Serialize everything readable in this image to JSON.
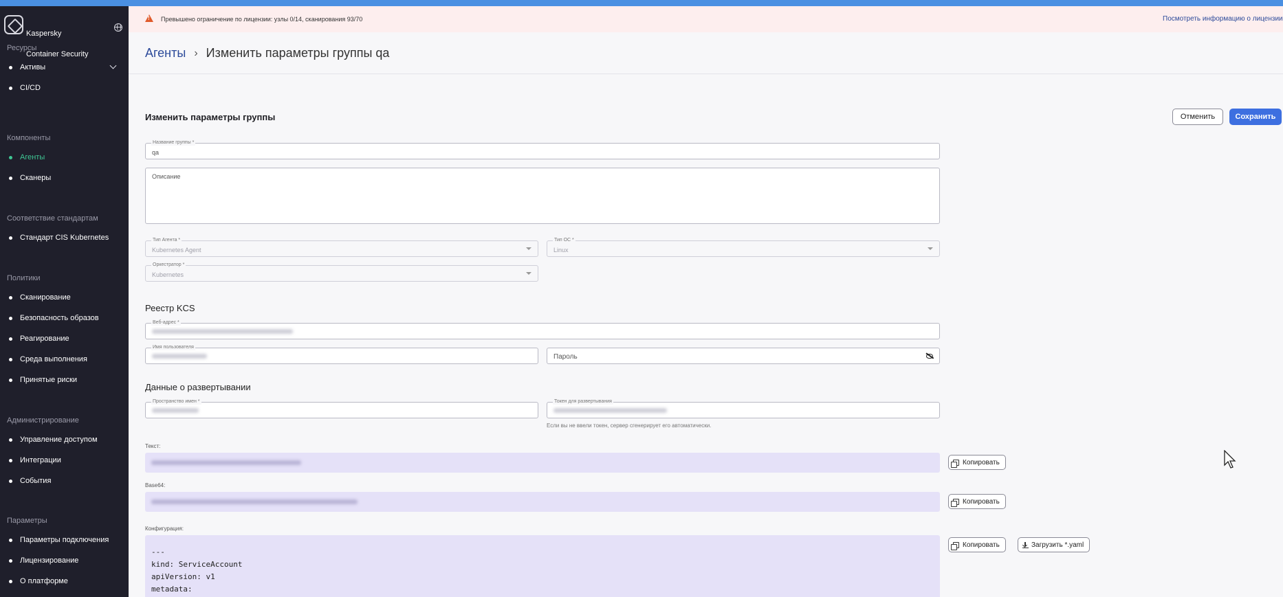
{
  "app": {
    "brand_line1": "Kaspersky",
    "brand_line2": "Container Security"
  },
  "sidebar": {
    "sections": [
      {
        "title": "Ресурсы",
        "items": [
          {
            "label": "Активы",
            "expandable": true
          },
          {
            "label": "CI/CD"
          }
        ]
      },
      {
        "title": "Компоненты",
        "items": [
          {
            "label": "Агенты",
            "active": true
          },
          {
            "label": "Сканеры"
          }
        ]
      },
      {
        "title": "Соответствие стандартам",
        "items": [
          {
            "label": "Стандарт CIS Kubernetes"
          }
        ]
      },
      {
        "title": "Политики",
        "items": [
          {
            "label": "Сканирование"
          },
          {
            "label": "Безопасность образов"
          },
          {
            "label": "Реагирование"
          },
          {
            "label": "Среда выполнения"
          },
          {
            "label": "Принятые риски"
          }
        ]
      },
      {
        "title": "Администрирование",
        "items": [
          {
            "label": "Управление доступом"
          },
          {
            "label": "Интеграции"
          },
          {
            "label": "События"
          }
        ]
      },
      {
        "title": "Параметры",
        "items": [
          {
            "label": "Параметры подключения"
          },
          {
            "label": "Лицензирование"
          },
          {
            "label": "О платформе"
          }
        ]
      }
    ]
  },
  "banner": {
    "text": "Превышено ограничение по лицензии: узлы 0/14, сканирования 93/70",
    "link": "Посмотреть информацию о лицензии"
  },
  "breadcrumb": {
    "parent": "Агенты",
    "separator": "›",
    "current": "Изменить параметры группы qa"
  },
  "form": {
    "title": "Изменить параметры группы",
    "cancel_label": "Отменить",
    "save_label": "Сохранить",
    "group_name": {
      "label": "Название группы *",
      "value": "qa"
    },
    "description": {
      "placeholder": "Описание"
    },
    "agent_type": {
      "label": "Тип Агента *",
      "value": "Kubernetes Agent"
    },
    "os_type": {
      "label": "Тип ОС *",
      "value": "Linux"
    },
    "orchestrator": {
      "label": "Оркестратор *",
      "value": "Kubernetes"
    },
    "registry_title": "Реестр KCS",
    "web_address": {
      "label": "Веб-адрес *"
    },
    "username": {
      "label": "Имя пользователя"
    },
    "password": {
      "placeholder": "Пароль"
    },
    "deploy_title": "Данные о развертывании",
    "namespace": {
      "label": "Пространство имен *"
    },
    "token": {
      "label": "Токен для развертывания",
      "hint": "Если вы не ввели токен, сервер сгенерирует его автоматически."
    },
    "text_label": "Текст:",
    "base64_label": "Base64:",
    "config_label": "Конфигурация:",
    "copy_label": "Копировать",
    "upload_label": "Загрузить *.yaml",
    "config_lines": [
      "---",
      "kind: ServiceAccount",
      "apiVersion: v1",
      "metadata:"
    ]
  },
  "colors": {
    "accent": "#3d6fe0",
    "sidebar_bg": "#1f1f2b",
    "active_nav": "#3fc794",
    "banner_bg": "#fdeeee",
    "code_bg": "#e5e1f8"
  },
  "icons": {
    "logo": "kaspersky-logo-icon",
    "language": "globe-icon",
    "warning": "warning-triangle-icon",
    "expand": "chevron-down-icon",
    "dropdown": "caret-down-icon",
    "password_visibility": "eye-off-icon",
    "copy": "copy-icon",
    "download": "download-icon"
  }
}
